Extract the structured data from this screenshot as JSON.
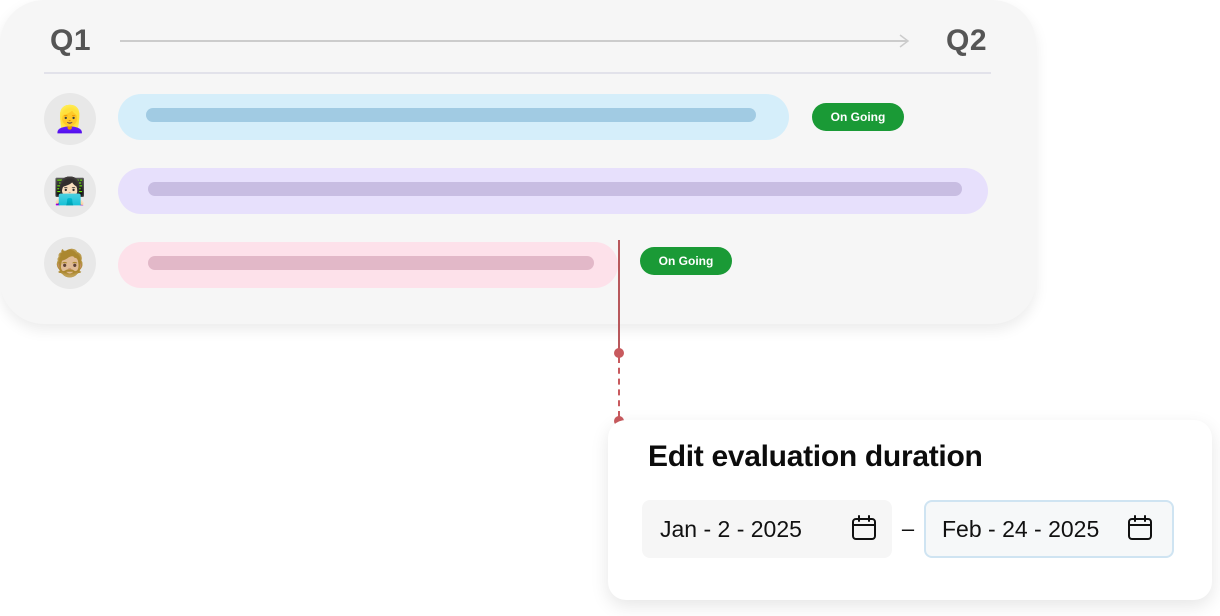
{
  "timeline": {
    "start_label": "Q1",
    "end_label": "Q2",
    "rows": [
      {
        "avatar": "👱‍♀️",
        "avatar_name": "blonde-woman-avatar",
        "color": "#d5eefa",
        "fill_color": "#a1cbe3",
        "status": "On Going"
      },
      {
        "avatar": "👩🏻‍💻",
        "avatar_name": "woman-technologist-avatar",
        "color": "#e7e0fc",
        "fill_color": "#c8bde2",
        "status": null
      },
      {
        "avatar": "🧔🏼",
        "avatar_name": "red-haired-man-avatar",
        "color": "#fde1ea",
        "fill_color": "#e2b8c8",
        "status": "On Going"
      }
    ],
    "status_color": "#1a9a36",
    "marker_color": "#c85a5e"
  },
  "dialog": {
    "title": "Edit evaluation duration",
    "start_date": "Jan - 2 - 2025",
    "separator": "–",
    "end_date": "Feb - 24 - 2025",
    "calendar_icon": "calendar-icon"
  }
}
